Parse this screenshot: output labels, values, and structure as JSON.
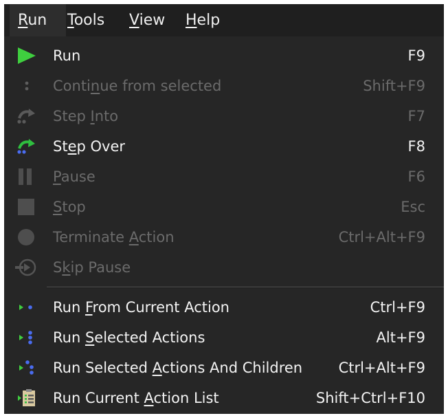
{
  "menubar": {
    "items": [
      {
        "pre": "",
        "u": "R",
        "post": "un",
        "active": true
      },
      {
        "pre": "",
        "u": "T",
        "post": "ools",
        "active": false
      },
      {
        "pre": "",
        "u": "V",
        "post": "iew",
        "active": false
      },
      {
        "pre": "",
        "u": "H",
        "post": "elp",
        "active": false
      }
    ]
  },
  "menu": {
    "items": [
      {
        "pre": "Run",
        "u": "",
        "post": "",
        "shortcut": "F9",
        "enabled": true,
        "icon": "play-icon"
      },
      {
        "pre": "Conti",
        "u": "n",
        "post": "ue from selected",
        "shortcut": "Shift+F9",
        "enabled": false,
        "icon": "continue-icon"
      },
      {
        "pre": "Step ",
        "u": "I",
        "post": "nto",
        "shortcut": "F7",
        "enabled": false,
        "icon": "step-into-icon"
      },
      {
        "pre": "St",
        "u": "e",
        "post": "p Over",
        "shortcut": "F8",
        "enabled": true,
        "icon": "step-over-icon"
      },
      {
        "pre": "",
        "u": "P",
        "post": "ause",
        "shortcut": "F6",
        "enabled": false,
        "icon": "pause-icon"
      },
      {
        "pre": "",
        "u": "S",
        "post": "top",
        "shortcut": "Esc",
        "enabled": false,
        "icon": "stop-icon"
      },
      {
        "pre": "Terminate ",
        "u": "A",
        "post": "ction",
        "shortcut": "Ctrl+Alt+F9",
        "enabled": false,
        "icon": "terminate-icon"
      },
      {
        "pre": "S",
        "u": "k",
        "post": "ip Pause",
        "shortcut": "",
        "enabled": false,
        "icon": "skip-pause-icon"
      },
      {
        "pre": "Run ",
        "u": "F",
        "post": "rom Current Action",
        "shortcut": "Ctrl+F9",
        "enabled": true,
        "icon": "run-from-current-icon"
      },
      {
        "pre": "Run ",
        "u": "S",
        "post": "elected Actions",
        "shortcut": "Alt+F9",
        "enabled": true,
        "icon": "run-selected-icon"
      },
      {
        "pre": "Run Selected ",
        "u": "A",
        "post": "ctions And Children",
        "shortcut": "Ctrl+Alt+F9",
        "enabled": true,
        "icon": "run-selected-children-icon"
      },
      {
        "pre": "Run Current ",
        "u": "A",
        "post": "ction List",
        "shortcut": "Shift+Ctrl+F10",
        "enabled": true,
        "icon": "run-action-list-icon"
      }
    ]
  },
  "colors": {
    "menubar_bg": "#1f1f1f",
    "active_menu_bg": "#2d2d2d",
    "dropdown_bg": "#262626",
    "text": "#f3f3f3",
    "disabled_text": "#6b6b6b",
    "accent_green": "#3fcf3f",
    "accent_blue": "#4a6cf0"
  }
}
